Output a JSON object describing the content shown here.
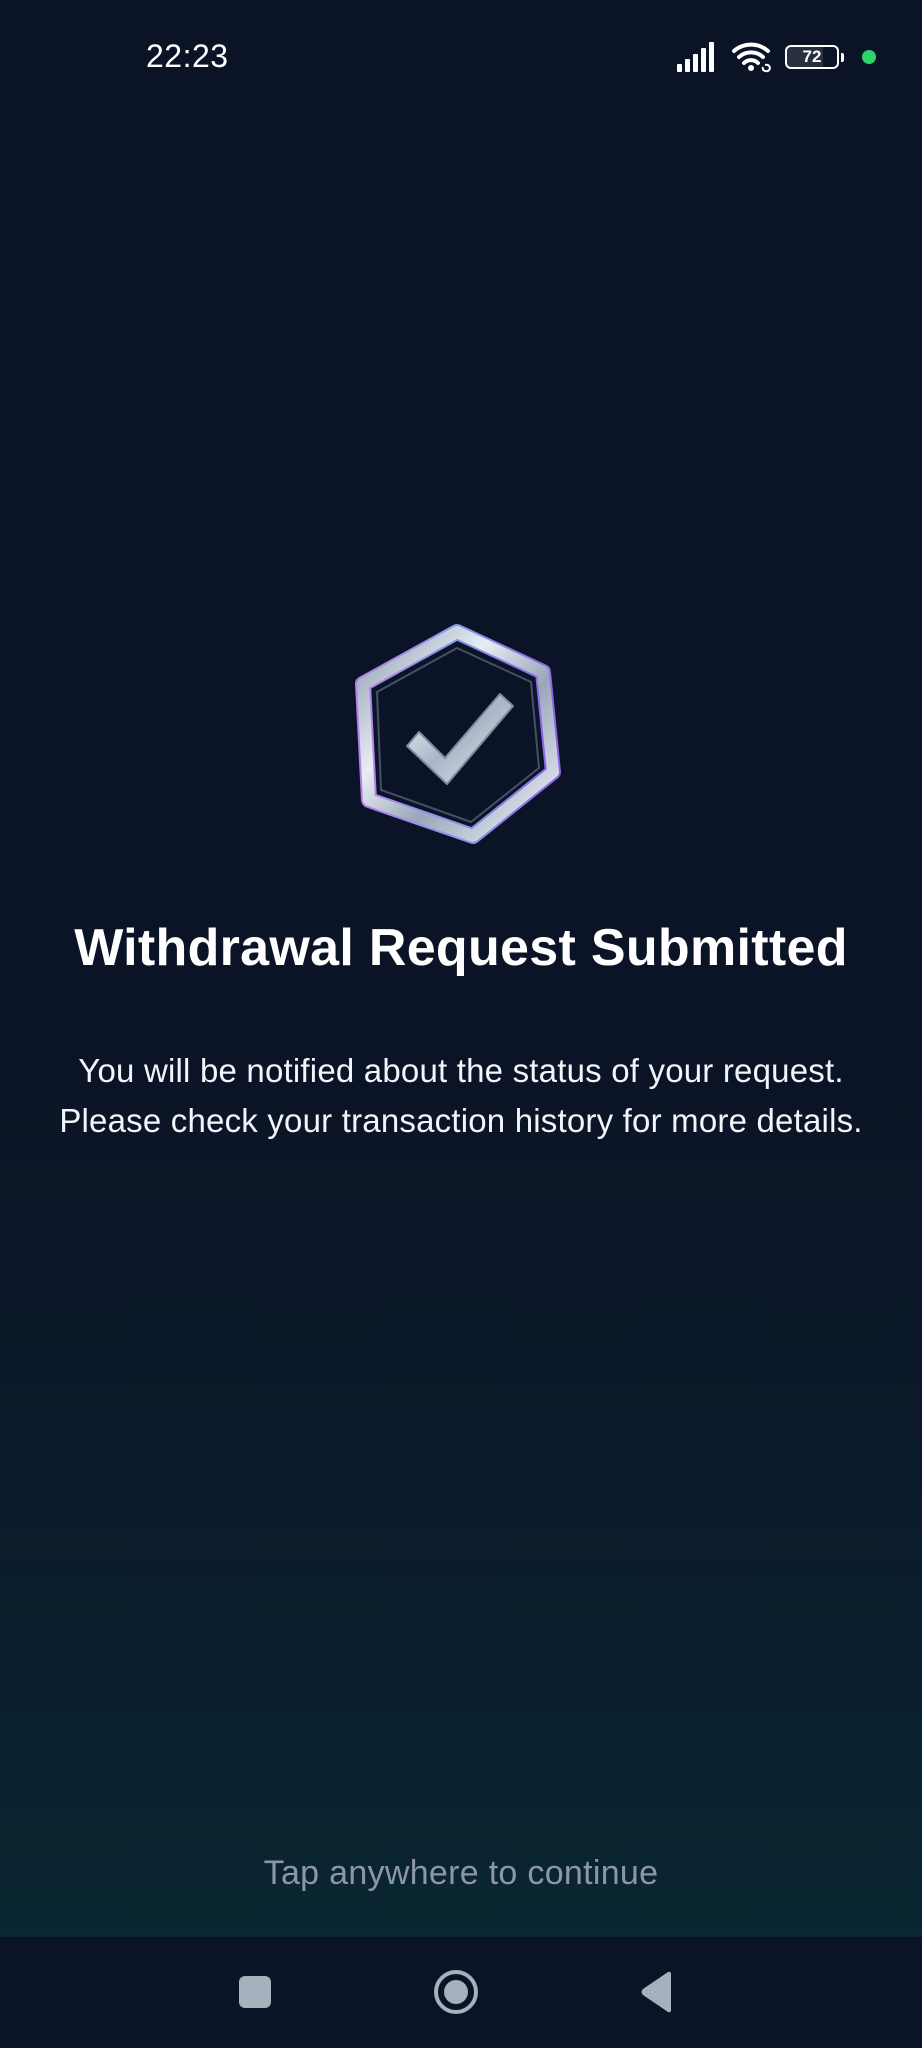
{
  "status_bar": {
    "time": "22:23",
    "battery_level": "72",
    "icons": [
      "signal-icon",
      "wifi-icon",
      "battery-icon",
      "privacy-dot-icon"
    ]
  },
  "confirmation": {
    "icon": "hexagon-checkmark-icon",
    "title": "Withdrawal Request Submitted",
    "message": "You will be notified about the status of your request. Please check your transaction history for more details.",
    "continue_hint": "Tap anywhere to continue"
  },
  "navigation_bar": {
    "buttons": [
      "recent-apps-icon",
      "home-icon",
      "back-icon"
    ]
  },
  "colors": {
    "background": "#0b1426",
    "gradient_bottom": "#092a33",
    "title": "#ffffff",
    "body_text": "#f2f5fa",
    "hint_text": "#8b97a8",
    "status_dot": "#2fd36a"
  }
}
